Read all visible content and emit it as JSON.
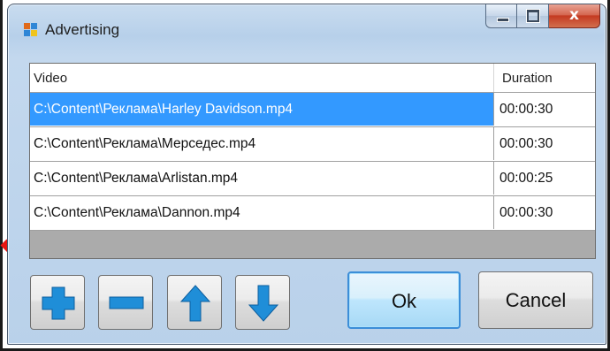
{
  "window": {
    "title": "Advertising",
    "caption_buttons": {
      "minimize": "minimize",
      "maximize": "maximize",
      "close": "close"
    }
  },
  "grid": {
    "columns": [
      "Video",
      "Duration"
    ],
    "rows": [
      {
        "video": "C:\\Content\\Реклама\\Harley Davidson.mp4",
        "duration": "00:00:30",
        "selected": true
      },
      {
        "video": "C:\\Content\\Реклама\\Мерседес.mp4",
        "duration": "00:00:30",
        "selected": false
      },
      {
        "video": "C:\\Content\\Реклама\\Arlistan.mp4",
        "duration": "00:00:25",
        "selected": false
      },
      {
        "video": "C:\\Content\\Реклама\\Dannon.mp4",
        "duration": "00:00:30",
        "selected": false
      }
    ]
  },
  "toolbar": {
    "add_icon": "plus-icon",
    "remove_icon": "minus-icon",
    "move_up_icon": "arrow-up-icon",
    "move_down_icon": "arrow-down-icon",
    "ok_label": "Ok",
    "cancel_label": "Cancel"
  },
  "colors": {
    "selection": "#3399ff",
    "icon_blue": "#1f8ed8",
    "pointer_arrow": "#e8130f"
  }
}
